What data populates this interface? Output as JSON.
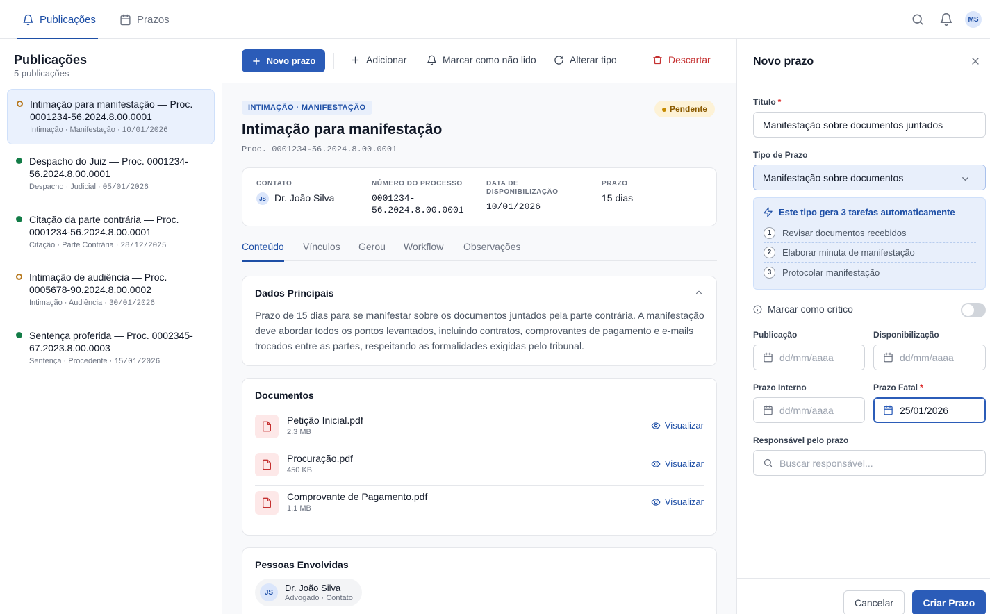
{
  "topnav": {
    "tabs": [
      {
        "label": "Publicações",
        "active": true
      },
      {
        "label": "Prazos",
        "active": false
      }
    ],
    "user_initials": "MS"
  },
  "sidebar": {
    "title": "Publicações",
    "subtitle": "5 publicações",
    "items": [
      {
        "title": "Intimação para manifestação — Proc. 0001234-56.2024.8.00.0001",
        "meta": "Intimação · Manifestação",
        "date": "10/01/2026",
        "status": "pending"
      },
      {
        "title": "Despacho do Juiz — Proc. 0001234-56.2024.8.00.0001",
        "meta": "Despacho · Judicial",
        "date": "05/01/2026",
        "status": "done"
      },
      {
        "title": "Citação da parte contrária — Proc. 0001234-56.2024.8.00.0001",
        "meta": "Citação · Parte Contrária",
        "date": "28/12/2025",
        "status": "done"
      },
      {
        "title": "Intimação de audiência — Proc. 0005678-90.2024.8.00.0002",
        "meta": "Intimação · Audiência",
        "date": "30/01/2026",
        "status": "pending"
      },
      {
        "title": "Sentença proferida — Proc. 0002345-67.2023.8.00.0003",
        "meta": "Sentença · Procedente",
        "date": "15/01/2026",
        "status": "done"
      }
    ]
  },
  "toolbar": {
    "new_label": "Novo prazo",
    "add_label": "Adicionar",
    "unread_label": "Marcar como não lido",
    "change_type_label": "Alterar tipo",
    "discard_label": "Descartar"
  },
  "detail": {
    "tag": "INTIMAÇÃO · MANIFESTAÇÃO",
    "status": "Pendente",
    "title": "Intimação para manifestação",
    "process": "Proc. 0001234-56.2024.8.00.0001",
    "info": {
      "contact_label": "CONTATO",
      "contact_initials": "JS",
      "contact_value": "Dr. João Silva",
      "process_label": "NÚMERO DO PROCESSO",
      "process_value": "0001234-56.2024.8.00.0001",
      "availability_label": "DATA DE DISPONIBILIZAÇÃO",
      "availability_value": "10/01/2026",
      "deadline_label": "PRAZO",
      "deadline_value": "15 dias"
    },
    "tabs": [
      "Conteúdo",
      "Vínculos",
      "Gerou",
      "Workflow",
      "Observações"
    ],
    "main_data": {
      "title": "Dados Principais",
      "text": "Prazo de 15 dias para se manifestar sobre os documentos juntados pela parte contrária. A manifestação deve abordar todos os pontos levantados, incluindo contratos, comprovantes de pagamento e e-mails trocados entre as partes, respeitando as formalidades exigidas pelo tribunal."
    },
    "documents": {
      "title": "Documentos",
      "view_label": "Visualizar",
      "items": [
        {
          "name": "Petição Inicial.pdf",
          "size": "2.3 MB"
        },
        {
          "name": "Procuração.pdf",
          "size": "450 KB"
        },
        {
          "name": "Comprovante de Pagamento.pdf",
          "size": "1.1 MB"
        }
      ]
    },
    "people": {
      "title": "Pessoas Envolvidas",
      "items": [
        {
          "initials": "JS",
          "name": "Dr. João Silva",
          "role": "Advogado · Contato"
        }
      ]
    }
  },
  "form": {
    "title": "Novo prazo",
    "title_label": "Título",
    "title_value": "Manifestação sobre documentos juntados",
    "type_label": "Tipo de Prazo",
    "type_value": "Manifestação sobre documentos",
    "auto_title": "Este tipo gera 3 tarefas automaticamente",
    "auto_tasks": [
      {
        "n": "1",
        "label": "Revisar documentos recebidos"
      },
      {
        "n": "2",
        "label": "Elaborar minuta de manifestação"
      },
      {
        "n": "3",
        "label": "Protocolar manifestação"
      }
    ],
    "critical_label": "Marcar como crítico",
    "critical_on": false,
    "publication_label": "Publicação",
    "availability_label": "Disponibilização",
    "internal_label": "Prazo Interno",
    "fatal_label": "Prazo Fatal",
    "date_placeholder": "dd/mm/aaaa",
    "fatal_value": "25/01/2026",
    "owner_label": "Responsável pelo prazo",
    "owner_placeholder": "Buscar responsável...",
    "cancel_label": "Cancelar",
    "create_label": "Criar Prazo"
  },
  "colors": {
    "accent": "#2b5cb8",
    "pending": "#b7791f",
    "done": "#137c47",
    "danger": "#c53030"
  }
}
